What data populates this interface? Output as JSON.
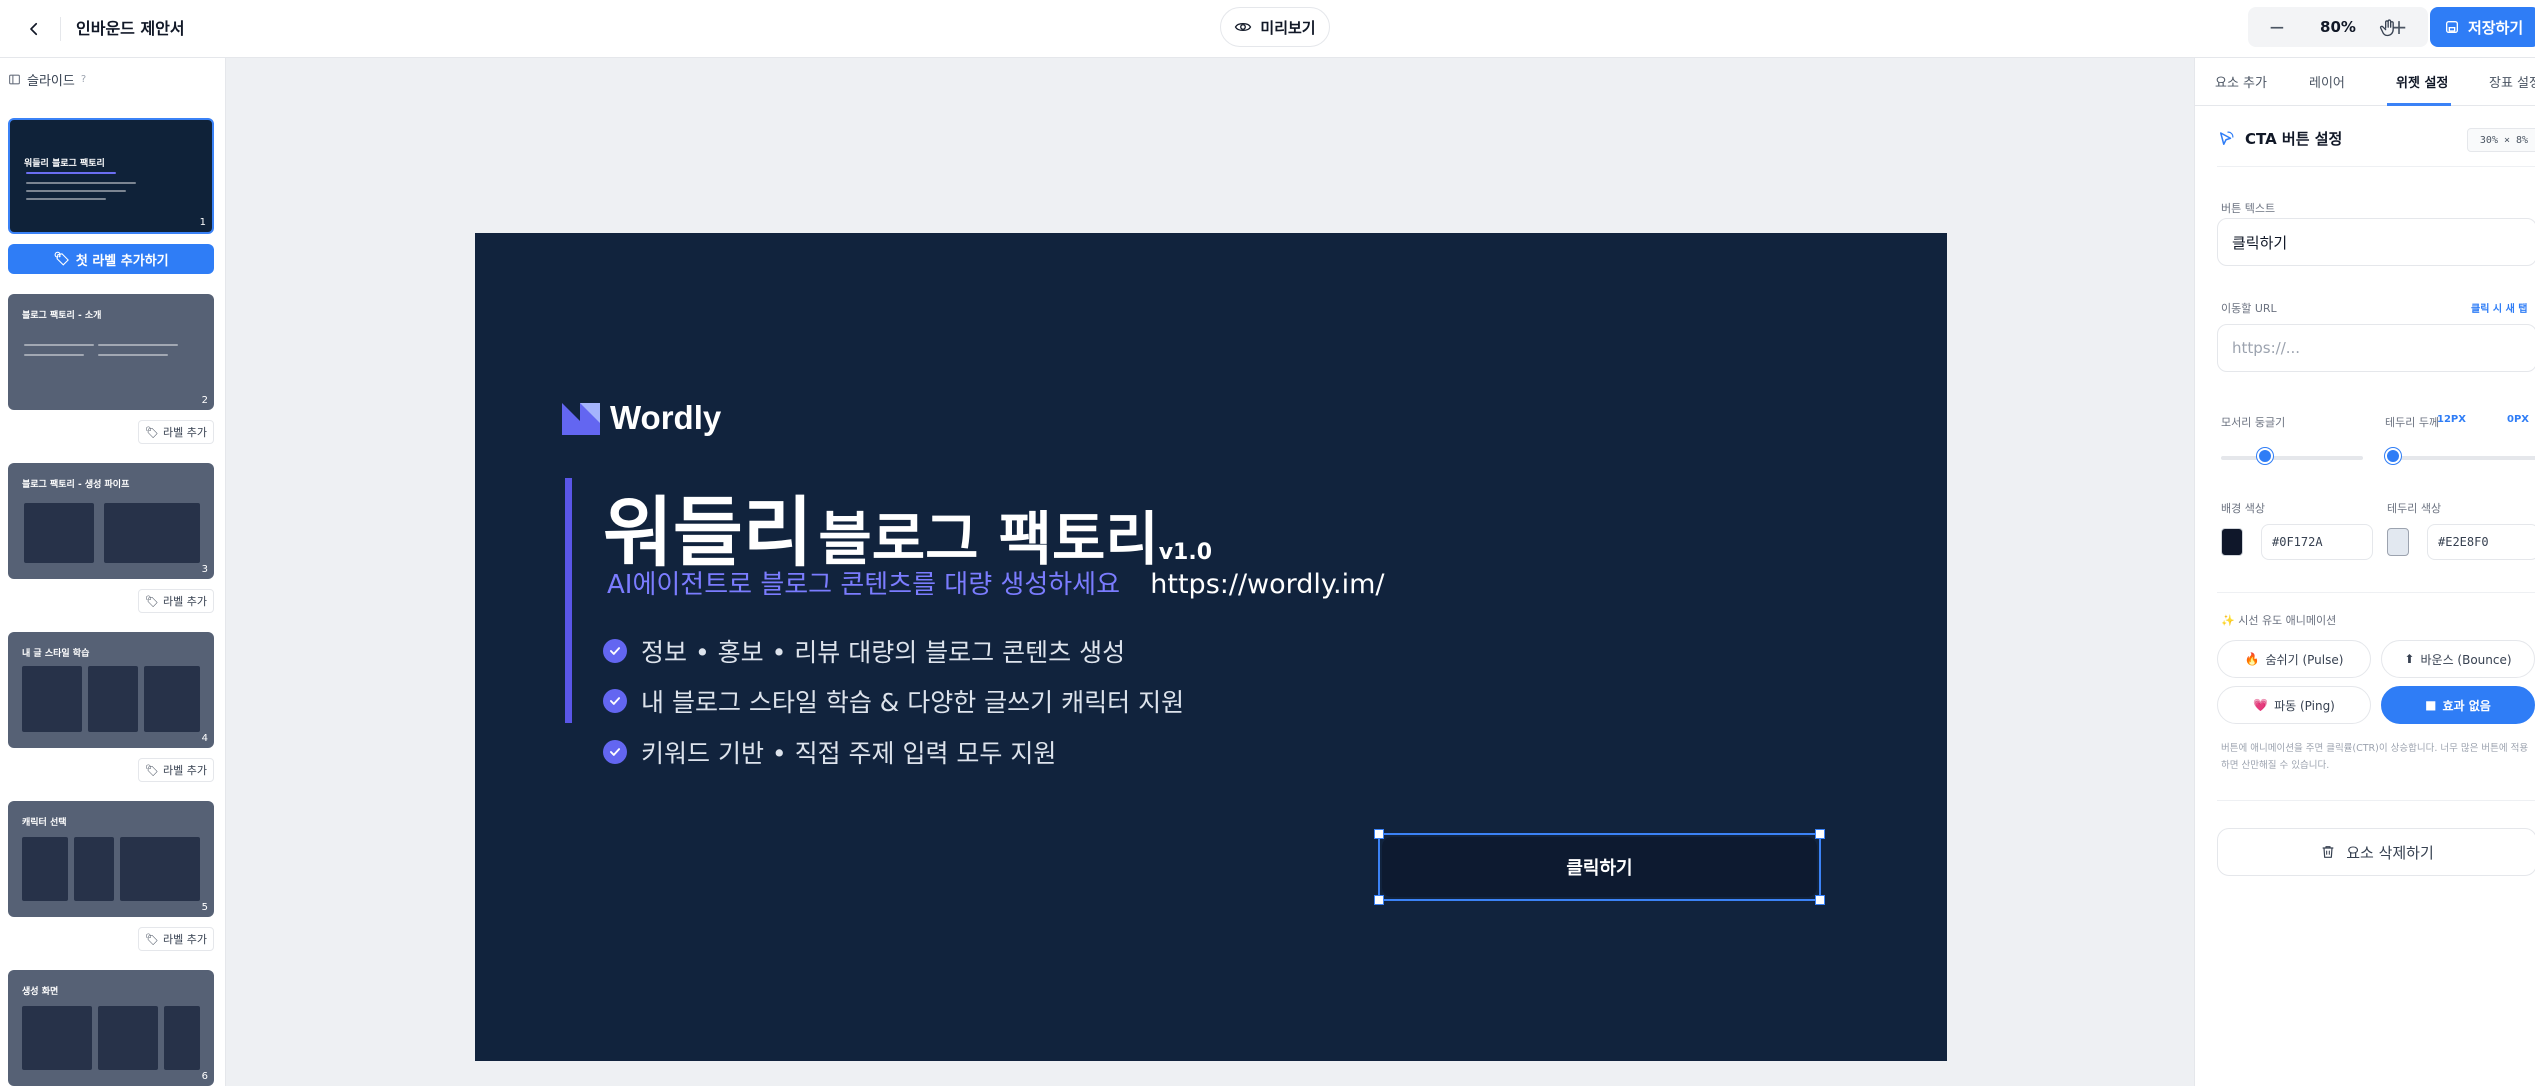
{
  "topbar": {
    "title": "인바운드 제안서",
    "preview_label": "미리보기",
    "zoom": "80%",
    "zoom_out": "−",
    "zoom_in": "+",
    "save_label": "저장하기"
  },
  "sidebar": {
    "header": "슬라이드",
    "help": "?",
    "add_main_label": "첫 라벨 추가하기",
    "add_label": "라벨 추가",
    "slides": [
      {
        "num": "1",
        "title": "워들리 블로그 팩토리"
      },
      {
        "num": "2",
        "title": "블로그 팩토리 - 소개"
      },
      {
        "num": "3",
        "title": "블로그 팩토리 - 생성 파이프"
      },
      {
        "num": "4",
        "title": "내 글 스타일 학습"
      },
      {
        "num": "5",
        "title": "캐릭터 선택"
      },
      {
        "num": "6",
        "title": "생성 화면"
      }
    ]
  },
  "slide": {
    "logo_text": "Wordly",
    "headline_big": "워들리",
    "headline_mid": "블로그 팩토리",
    "version": "v1.0",
    "subtitle": "AI에이전트로 블로그 콘텐츠를 대량 생성하세요",
    "url": "https://wordly.im/",
    "features": [
      "정보 • 홍보 • 리뷰 대량의 블로그 콘텐츠 생성",
      "내 블로그 스타일 학습 & 다양한 글쓰기 캐릭터 지원",
      "키워드 기반 • 직접 주제 입력 모두 지원"
    ],
    "cta_text": "클릭하기"
  },
  "panel": {
    "tabs": [
      "요소 추가",
      "레이어",
      "위젯 설정",
      "장표 설정"
    ],
    "active_tab": "위젯 설정",
    "section_title": "CTA 버튼 설정",
    "size_chip": "30% × 8%",
    "button_text_label": "버튼 텍스트",
    "button_text_value": "클릭하기",
    "url_label": "이동할 URL",
    "url_badge": "클릭 시 새 탭",
    "url_placeholder": "https://...",
    "radius_label": "모서리 둥글기",
    "radius_value": "12PX",
    "radius_level": 0.3,
    "border_label": "테두리 두께",
    "border_value": "0PX",
    "border_level": 0,
    "bg_label": "배경 색상",
    "bg_hex": "#0F172A",
    "border_color_label": "테두리 색상",
    "border_hex": "#E2E8F0",
    "anim_label": "시선 유도 애니메이션",
    "anims": [
      {
        "icon": "🔥",
        "label": "숨쉬기 (Pulse)"
      },
      {
        "icon": "⬆",
        "label": "바운스 (Bounce)"
      },
      {
        "icon": "💗",
        "label": "파동 (Ping)"
      },
      {
        "icon": "■",
        "label": "효과 없음"
      }
    ],
    "anim_note": "버튼에 애니메이션을 주면 클릭률(CTR)이 상승합니다. 너무 많은 버튼에 적용하면 산만해질 수 있습니다.",
    "delete_label": "요소 삭제하기"
  },
  "colors": {
    "accent": "#2f7df6",
    "slide_bg": "#11233d",
    "purple": "#5a56e8"
  }
}
